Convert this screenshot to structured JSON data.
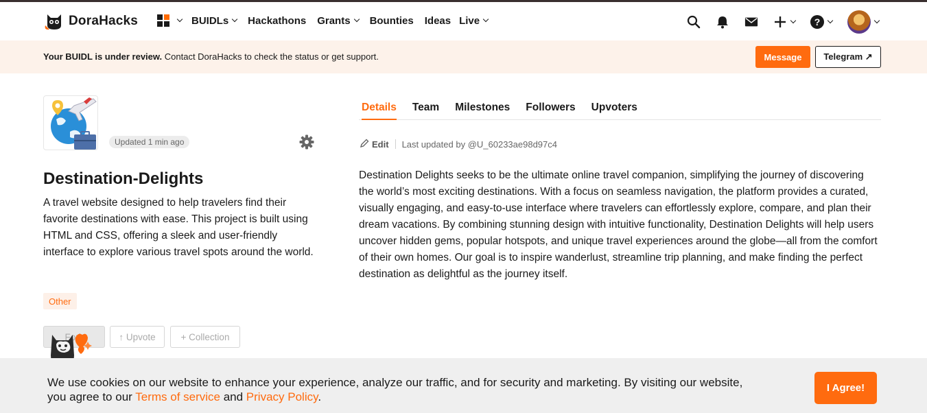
{
  "header": {
    "brand": "DoraHacks",
    "nav": [
      {
        "label": "BUIDLs",
        "has_menu": true
      },
      {
        "label": "Hackathons",
        "has_menu": false
      },
      {
        "label": "Grants",
        "has_menu": true
      },
      {
        "label": "Bounties",
        "has_menu": false
      },
      {
        "label": "Ideas",
        "has_menu": false
      },
      {
        "label": "Live",
        "has_menu": true
      }
    ],
    "icons": [
      "search-icon",
      "bell-icon",
      "mail-icon",
      "plus-icon",
      "help-icon",
      "avatar"
    ]
  },
  "banner": {
    "bold": "Your BUIDL is under review.",
    "text": " Contact DoraHacks to check the status or get support.",
    "message_label": "Message",
    "telegram_label": "Telegram ↗"
  },
  "project": {
    "updated": "Updated 1 min ago",
    "title": "Destination-Delights",
    "description": "A travel website designed to help travelers find their favorite destinations with ease. This project is built using HTML and CSS, offering a sleek and user-friendly interface to explore various travel spots around the world.",
    "tag": "Other",
    "actions": {
      "fork": "Fork",
      "upvote": "↑ Upvote",
      "collection": "+ Collection"
    }
  },
  "tabs": [
    {
      "label": "Details",
      "active": true
    },
    {
      "label": "Team",
      "active": false
    },
    {
      "label": "Milestones",
      "active": false
    },
    {
      "label": "Followers",
      "active": false
    },
    {
      "label": "Upvoters",
      "active": false
    }
  ],
  "details": {
    "edit_label": "Edit",
    "last_updated": "Last updated by @U_60233ae98d97c4",
    "body": "Destination Delights seeks to be the ultimate online travel companion, simplifying the journey of discovering the world’s most exciting destinations. With a focus on seamless navigation, the platform provides a curated, visually engaging, and easy-to-use interface where travelers can effortlessly explore, compare, and plan their dream vacations. By combining stunning design with intuitive functionality, Destination Delights will help users uncover hidden gems, popular hotspots, and unique travel experiences around the globe—all from the comfort of their own homes. Our goal is to inspire wanderlust, streamline trip planning, and make finding the perfect destination as delightful as the journey itself."
  },
  "cookie": {
    "text_before": "We use cookies on our website to enhance your experience, analyze our traffic, and for security and marketing. By visiting our website, you agree to our ",
    "terms": "Terms of service",
    "and": " and ",
    "privacy": "Privacy Policy",
    "end": ".",
    "agree_label": "I Agree!"
  },
  "colors": {
    "accent": "#ff6b0f",
    "banner_bg": "#fdf2ea",
    "cookie_bg": "#efefef"
  }
}
